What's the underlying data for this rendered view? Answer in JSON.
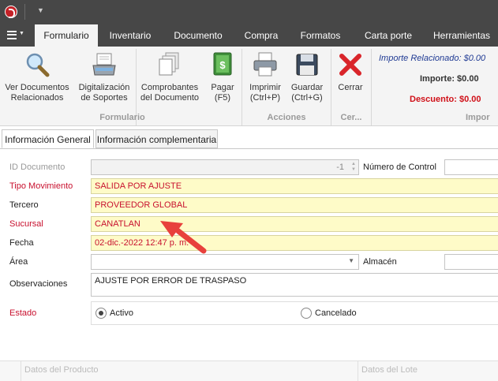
{
  "ribbon_tabs": [
    "Formulario",
    "Inventario",
    "Documento",
    "Compra",
    "Formatos",
    "Carta porte",
    "Herramientas"
  ],
  "active_tab": "Formulario",
  "buttons": {
    "ver_docs": "Ver Documentos\nRelacionados",
    "digitalizacion": "Digitalización\nde Soportes",
    "comprobantes": "Comprobantes\ndel Documento",
    "pagar": "Pagar\n(F5)",
    "imprimir": "Imprimir\n(Ctrl+P)",
    "guardar": "Guardar\n(Ctrl+G)",
    "cerrar": "Cerrar"
  },
  "groups": {
    "formulario": "Formulario",
    "acciones": "Acciones",
    "cerrar": "Cer...",
    "importes": "Impor"
  },
  "importes": {
    "relacionado": "Importe Relacionado: $0.00",
    "importe": "Importe: $0.00",
    "descuento": "Descuento: $0.00"
  },
  "form_tabs": [
    "Información General",
    "Información complementaria"
  ],
  "labels": {
    "id_documento": "ID Documento",
    "tipo_movimiento": "Tipo Movimiento",
    "tercero": "Tercero",
    "sucursal": "Sucursal",
    "fecha": "Fecha",
    "area": "Área",
    "observaciones": "Observaciones",
    "estado": "Estado",
    "numero_control": "Número de Control",
    "almacen": "Almacén"
  },
  "values": {
    "id_documento": "-1",
    "tipo_movimiento": "SALIDA POR AJUSTE",
    "tercero": "PROVEEDOR GLOBAL",
    "sucursal": "CANATLAN",
    "fecha": "02-dic.-2022 12:47 p. m.",
    "area": "",
    "observaciones": "AJUSTE POR ERROR DE TRASPASO",
    "numero_control": "",
    "almacen": ""
  },
  "estado_options": [
    "Activo",
    "Cancelado"
  ],
  "estado_selected": "Activo",
  "grid": {
    "datos_producto": "Datos del Producto",
    "datos_lote": "Datos del Lote"
  },
  "colors": {
    "titlebar": "#474747",
    "required_label": "#c8102e",
    "highlight_field": "#fefbc8",
    "annotation_arrow": "#e8413c",
    "importe_relacionado": "#1f3a93"
  }
}
